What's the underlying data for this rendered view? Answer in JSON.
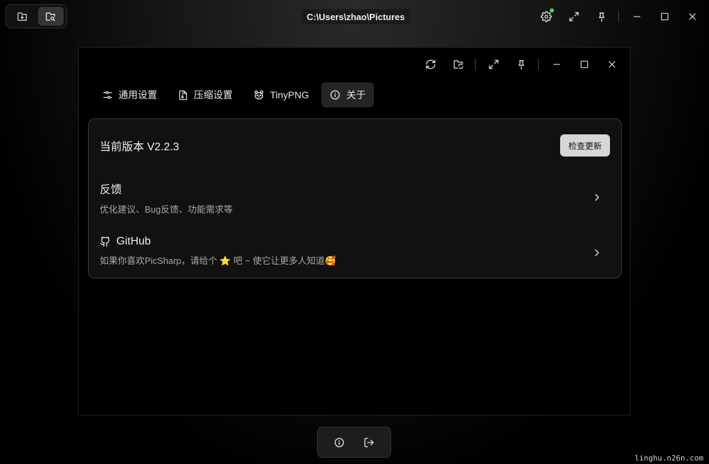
{
  "window": {
    "path_title": "C:\\Users\\zhao\\Pictures"
  },
  "mode_switch": {
    "items": [
      {
        "icon": "folder-download-icon",
        "active": false
      },
      {
        "icon": "folder-search-icon",
        "active": true
      }
    ]
  },
  "top_actions": {
    "icons": [
      "gear-icon",
      "expand-icon",
      "pin-icon",
      "minimize-icon",
      "maximize-icon",
      "close-icon"
    ],
    "settings_has_update_dot": true,
    "dot_color": "#3ddc6a"
  },
  "settings_window": {
    "toolbar_icons": [
      "refresh-icon",
      "folder-refresh-icon",
      "expand-icon",
      "pin-icon",
      "minimize-icon",
      "maximize-icon",
      "close-icon"
    ],
    "tabs": [
      {
        "label": "通用设置",
        "icon": "sliders-icon",
        "active": false
      },
      {
        "label": "压缩设置",
        "icon": "file-zip-icon",
        "active": false
      },
      {
        "label": "TinyPNG",
        "icon": "panda-icon",
        "active": false
      },
      {
        "label": "关于",
        "icon": "info-icon",
        "active": true
      }
    ],
    "about": {
      "version_label": "当前版本 V2.2.3",
      "check_update_button": "检查更新",
      "feedback": {
        "title": "反馈",
        "description": "优化建议、Bug反馈、功能需求等"
      },
      "github": {
        "title": "GitHub",
        "description": "如果你喜欢PicSharp，请给个 ⭐ 吧 ~ 使它让更多人知道🥰"
      }
    }
  },
  "dock": {
    "icons": [
      "info-icon",
      "logout-icon"
    ]
  },
  "watermark": "linghu.n26n.com"
}
